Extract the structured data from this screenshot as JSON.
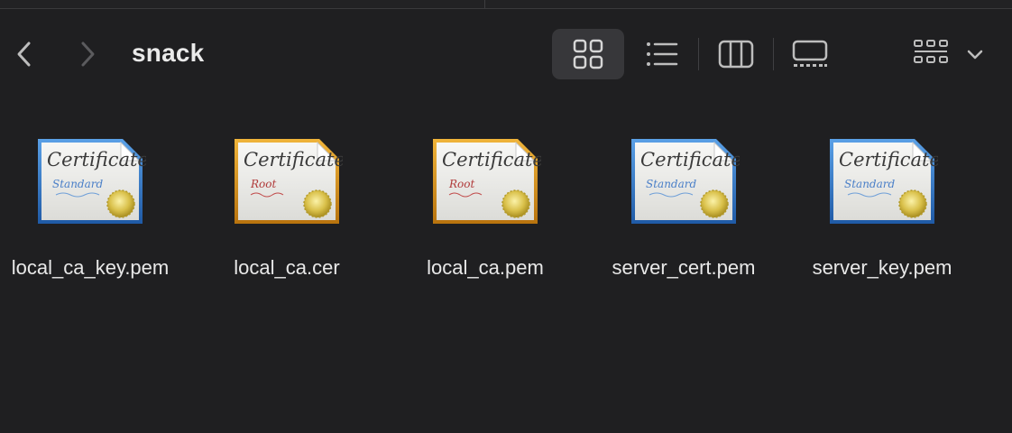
{
  "window": {
    "title": "snack"
  },
  "toolbar": {
    "back_icon": "chevron-left-icon",
    "forward_icon": "chevron-right-icon",
    "views": [
      {
        "name": "icons",
        "icon": "grid-icon",
        "selected": true
      },
      {
        "name": "list",
        "icon": "list-icon",
        "selected": false
      },
      {
        "name": "columns",
        "icon": "columns-icon",
        "selected": false
      },
      {
        "name": "gallery",
        "icon": "gallery-icon",
        "selected": false
      }
    ],
    "group_icon": "group-grid-icon",
    "group_chevron": "chevron-down-icon"
  },
  "files": [
    {
      "name": "local_ca_key.pem",
      "type": "standard",
      "icon": "certificate-standard-icon"
    },
    {
      "name": "local_ca.cer",
      "type": "root",
      "icon": "certificate-root-icon"
    },
    {
      "name": "local_ca.pem",
      "type": "root",
      "icon": "certificate-root-icon"
    },
    {
      "name": "server_cert.pem",
      "type": "standard",
      "icon": "certificate-standard-icon"
    },
    {
      "name": "server_key.pem",
      "type": "standard",
      "icon": "certificate-standard-icon"
    }
  ],
  "certificate_icon_text": {
    "heading": "Certificate",
    "standard": "Standard",
    "root": "Root"
  },
  "colors": {
    "background": "#1f1f21",
    "selected_view_bg": "#37373a",
    "standard_border": "#2f6fb8",
    "root_border": "#c98a1c",
    "seal": "#d8c24a"
  }
}
